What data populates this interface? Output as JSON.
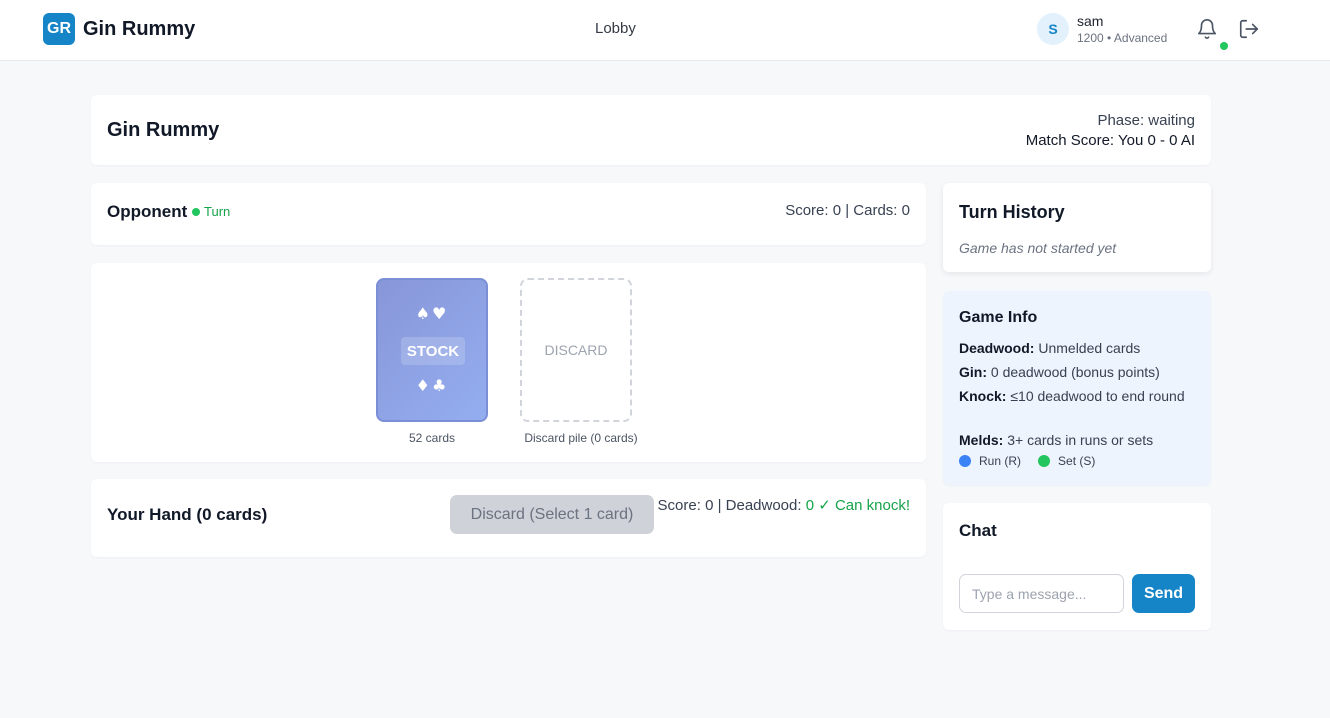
{
  "header": {
    "logo_text": "GR",
    "app_name": "Gin Rummy",
    "nav_lobby": "Lobby",
    "user": {
      "avatar_initial": "S",
      "name": "sam",
      "rating": "1200 • Advanced"
    },
    "icons": [
      "bell-icon",
      "logout-icon"
    ],
    "notification_dot_color": "#22c55e"
  },
  "game": {
    "title": "Gin Rummy",
    "phase": "Phase: waiting",
    "match_score": "Match Score: You 0 - 0 AI"
  },
  "opponent": {
    "label": "Opponent",
    "turn_label": "Turn",
    "stats": "Score: 0 | Cards: 0"
  },
  "table": {
    "stock_suits_top": "♠♥",
    "stock_suits_bottom": "♦♣",
    "stock_label": "STOCK",
    "stock_count": "52 cards",
    "discard_label": "DISCARD",
    "discard_count": "Discard pile (0 cards)"
  },
  "hand": {
    "title": "Your Hand (0 cards)",
    "discard_button": "Discard (Select 1 card)",
    "stats_prefix": "Score: 0 | Deadwood: ",
    "stats_status": "0 ✓ Can knock!"
  },
  "history": {
    "title": "Turn History",
    "empty_text": "Game has not started yet"
  },
  "info": {
    "title": "Game Info",
    "rules": [
      {
        "term": "Deadwood:",
        "text": " Unmelded cards"
      },
      {
        "term": "Gin:",
        "text": " 0 deadwood (bonus points)"
      },
      {
        "term": "Knock:",
        "text": " ≤10 deadwood to end round"
      },
      {
        "term": "Melds:",
        "text": " 3+ cards in runs or sets"
      }
    ],
    "legend": [
      {
        "label": "Run (R)",
        "color": "#3b82f6"
      },
      {
        "label": "Set (S)",
        "color": "#22c55e"
      }
    ]
  },
  "chat": {
    "title": "Chat",
    "input_placeholder": "Type a message...",
    "send_label": "Send"
  },
  "colors": {
    "accent": "#1585c8",
    "success": "#16a34a",
    "info_bg": "#eef4fd"
  }
}
